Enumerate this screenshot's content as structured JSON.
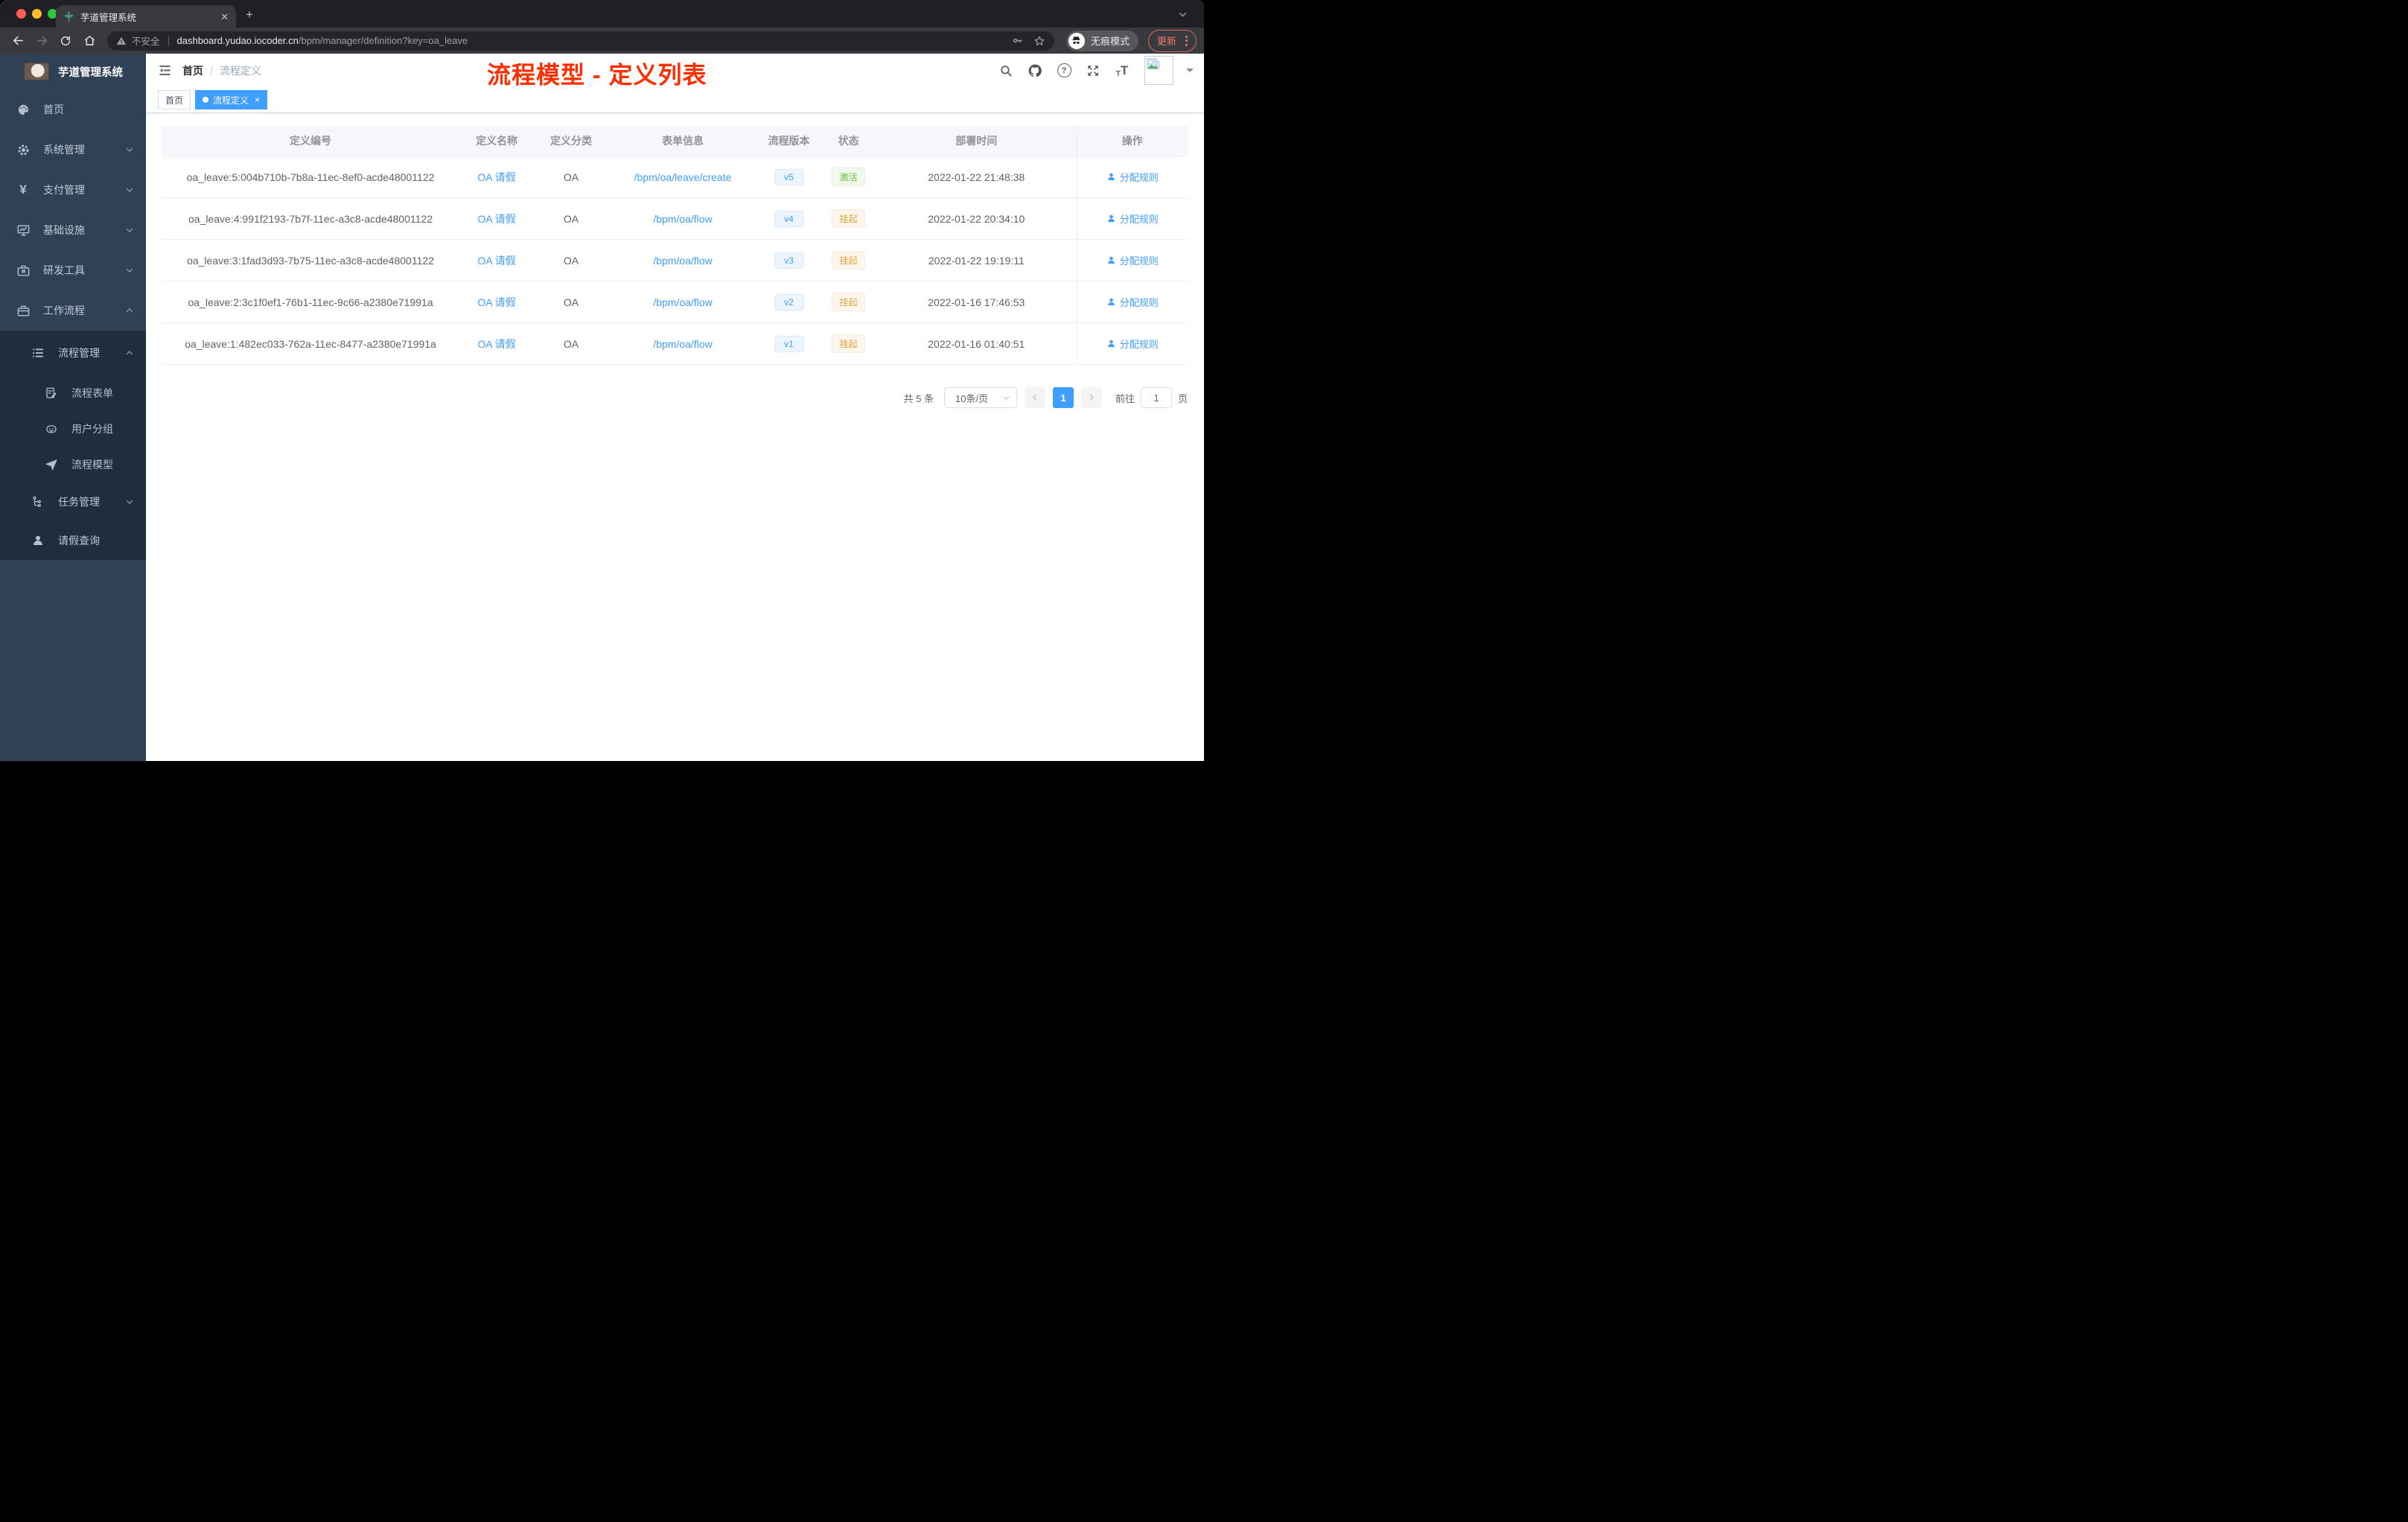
{
  "browser": {
    "tab_title": "芋道管理系统",
    "security_label": "不安全",
    "url_domain": "dashboard.yudao.iocoder.cn",
    "url_path": "/bpm/manager/definition?key=oa_leave",
    "incognito_label": "无痕模式",
    "update_label": "更新"
  },
  "sidebar": {
    "logo_title": "芋道管理系统",
    "items": [
      {
        "label": "首页",
        "icon": "dashboard-icon"
      },
      {
        "label": "系统管理",
        "icon": "gear-icon",
        "state": "collapsed"
      },
      {
        "label": "支付管理",
        "icon": "yen-icon",
        "state": "collapsed"
      },
      {
        "label": "基础设施",
        "icon": "monitor-icon",
        "state": "collapsed"
      },
      {
        "label": "研发工具",
        "icon": "toolbox-icon",
        "state": "collapsed"
      },
      {
        "label": "工作流程",
        "icon": "briefcase-icon",
        "state": "expanded"
      }
    ],
    "submenu": [
      {
        "label": "流程管理",
        "icon": "list-icon",
        "state": "expanded"
      },
      {
        "label": "流程表单",
        "icon": "form-icon"
      },
      {
        "label": "用户分组",
        "icon": "robot-icon"
      },
      {
        "label": "流程模型",
        "icon": "paper-plane-icon"
      },
      {
        "label": "任务管理",
        "icon": "tree-icon",
        "state": "collapsed"
      },
      {
        "label": "请假查询",
        "icon": "user-icon"
      }
    ]
  },
  "header": {
    "breadcrumb": {
      "home": "首页",
      "separator": "/",
      "current": "流程定义"
    },
    "annotation": "流程模型 - 定义列表"
  },
  "tags": {
    "home": "首页",
    "active": "流程定义"
  },
  "table": {
    "columns": [
      "定义编号",
      "定义名称",
      "定义分类",
      "表单信息",
      "流程版本",
      "状态",
      "部署时间",
      "操作"
    ],
    "action_label": "分配规则",
    "rows": [
      {
        "id": "oa_leave:5:004b710b-7b8a-11ec-8ef0-acde48001122",
        "name": "OA 请假",
        "category": "OA",
        "form": "/bpm/oa/leave/create",
        "version": "v5",
        "status": "激活",
        "status_type": "success",
        "time": "2022-01-22 21:48:38"
      },
      {
        "id": "oa_leave:4:991f2193-7b7f-11ec-a3c8-acde48001122",
        "name": "OA 请假",
        "category": "OA",
        "form": "/bpm/oa/flow",
        "version": "v4",
        "status": "挂起",
        "status_type": "warning",
        "time": "2022-01-22 20:34:10"
      },
      {
        "id": "oa_leave:3:1fad3d93-7b75-11ec-a3c8-acde48001122",
        "name": "OA 请假",
        "category": "OA",
        "form": "/bpm/oa/flow",
        "version": "v3",
        "status": "挂起",
        "status_type": "warning",
        "time": "2022-01-22 19:19:11"
      },
      {
        "id": "oa_leave:2:3c1f0ef1-76b1-11ec-9c66-a2380e71991a",
        "name": "OA 请假",
        "category": "OA",
        "form": "/bpm/oa/flow",
        "version": "v2",
        "status": "挂起",
        "status_type": "warning",
        "time": "2022-01-16 17:46:53"
      },
      {
        "id": "oa_leave:1:482ec033-762a-11ec-8477-a2380e71991a",
        "name": "OA 请假",
        "category": "OA",
        "form": "/bpm/oa/flow",
        "version": "v1",
        "status": "挂起",
        "status_type": "warning",
        "time": "2022-01-16 01:40:51"
      }
    ]
  },
  "pagination": {
    "total": "共 5 条",
    "page_size": "10条/页",
    "current_page": "1",
    "goto_label": "前往",
    "goto_value": "1",
    "unit_label": "页"
  },
  "colors": {
    "accent_blue": "#409eff",
    "success_green": "#67c23a",
    "warning_orange": "#e6a23c",
    "annotation_red": "#ff2e00",
    "sidebar_bg": "#304156",
    "submenu_bg": "#1f2d3d",
    "chrome_dark": "#1f2023",
    "chrome_toolbar": "#383a3e",
    "update_red": "#f07b6c"
  }
}
